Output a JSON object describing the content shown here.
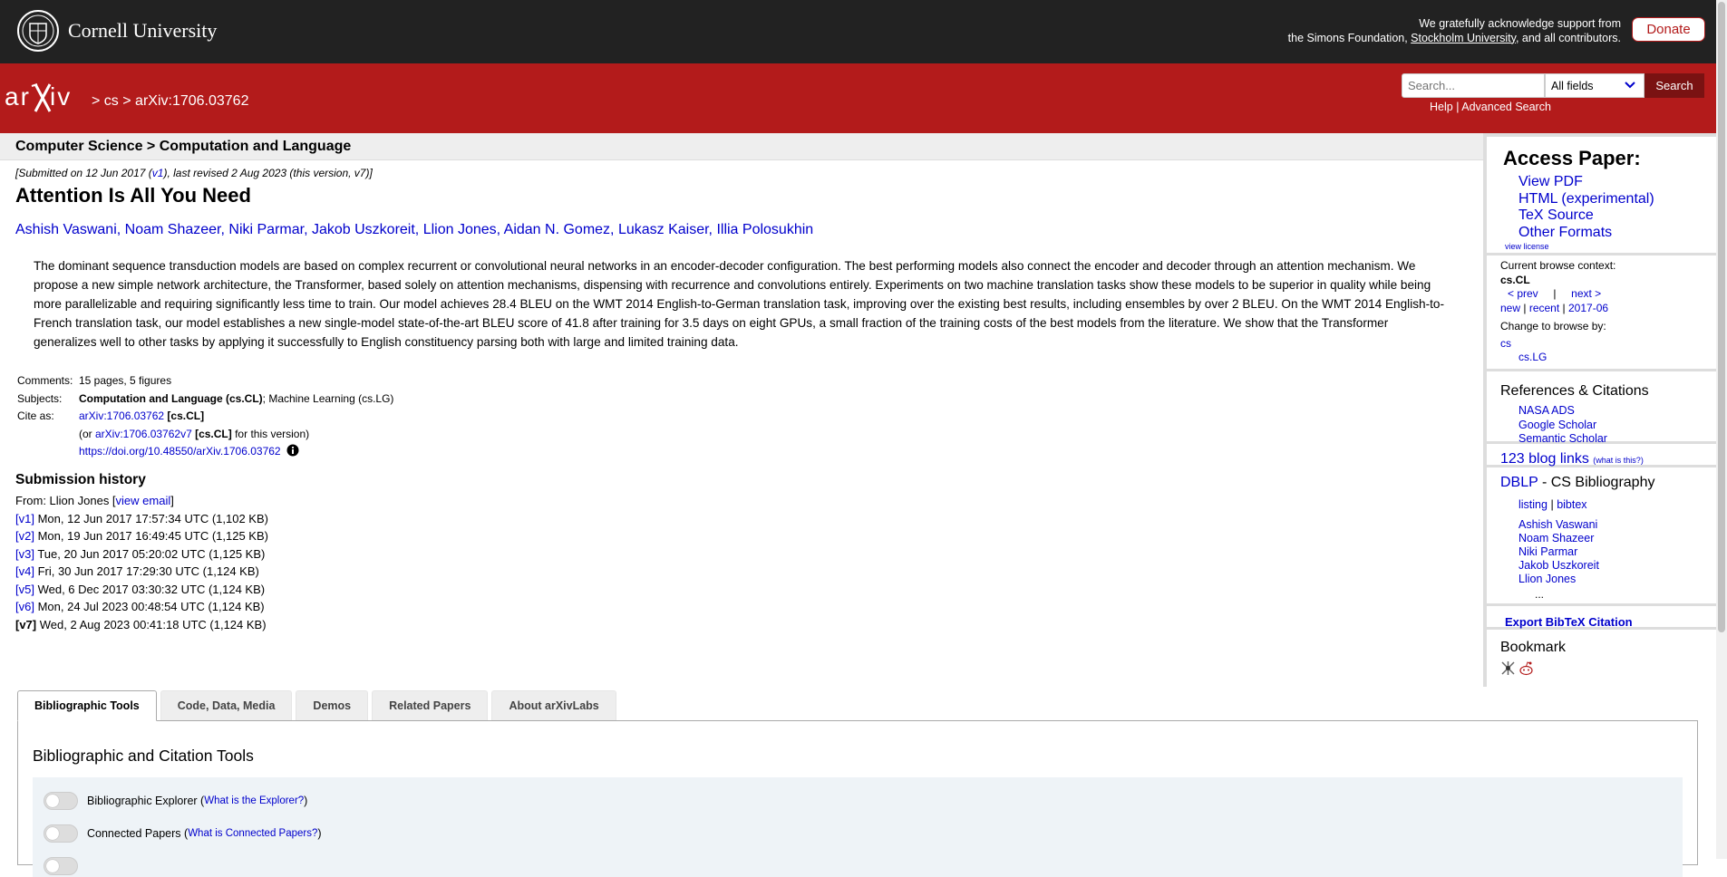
{
  "topbar": {
    "institution": "Cornell University",
    "ack_line1": "We gratefully acknowledge support from",
    "ack_line2_pre": "the Simons Foundation, ",
    "ack_link": "Stockholm University",
    "ack_line2_post": ", and all contributors.",
    "donate_label": "Donate"
  },
  "header": {
    "sep": ">",
    "crumb_cs": "cs",
    "crumb_id": "arXiv:1706.03762",
    "search_placeholder": "Search...",
    "search_field": "All fields",
    "search_button": "Search",
    "help": "Help",
    "help_sep": "|",
    "advanced": "Advanced Search",
    "colors": {
      "red": "#b31b1b",
      "dark": "#222222",
      "link": "#0000cc"
    }
  },
  "paper": {
    "category_heading": "Computer Science > Computation and Language",
    "dateline_pre": "[Submitted on 12 Jun 2017 (",
    "dateline_v1": "v1",
    "dateline_post": "), last revised 2 Aug 2023 (this version, v7)]",
    "title": "Attention Is All You Need",
    "authors": [
      "Ashish Vaswani",
      "Noam Shazeer",
      "Niki Parmar",
      "Jakob Uszkoreit",
      "Llion Jones",
      "Aidan N. Gomez",
      "Lukasz Kaiser",
      "Illia Polosukhin"
    ],
    "abstract": "The dominant sequence transduction models are based on complex recurrent or convolutional neural networks in an encoder-decoder configuration. The best performing models also connect the encoder and decoder through an attention mechanism. We propose a new simple network architecture, the Transformer, based solely on attention mechanisms, dispensing with recurrence and convolutions entirely. Experiments on two machine translation tasks show these models to be superior in quality while being more parallelizable and requiring significantly less time to train. Our model achieves 28.4 BLEU on the WMT 2014 English-to-German translation task, improving over the existing best results, including ensembles by over 2 BLEU. On the WMT 2014 English-to-French translation task, our model establishes a new single-model state-of-the-art BLEU score of 41.8 after training for 3.5 days on eight GPUs, a small fraction of the training costs of the best models from the literature. We show that the Transformer generalizes well to other tasks by applying it successfully to English constituency parsing both with large and limited training data.",
    "meta": {
      "comments_label": "Comments:",
      "comments": "15 pages, 5 figures",
      "subjects_label": "Subjects:",
      "subject_primary": "Computation and Language (cs.CL)",
      "subject_rest": "; Machine Learning (cs.LG)",
      "cite_label": "Cite as:",
      "cite_id": "arXiv:1706.03762",
      "cite_cat": " [cs.CL]",
      "cite_or_pre": "(or ",
      "cite_v7": "arXiv:1706.03762v7",
      "cite_v7_cat": " [cs.CL]",
      "cite_or_post": " for this version)",
      "doi": "https://doi.org/10.48550/arXiv.1706.03762"
    },
    "history": {
      "heading": "Submission history",
      "from_pre": "From: Llion Jones [",
      "from_link": "view email",
      "from_post": "]",
      "versions": [
        {
          "v": "[v1]",
          "text": " Mon, 12 Jun 2017 17:57:34 UTC (1,102 KB)"
        },
        {
          "v": "[v2]",
          "text": " Mon, 19 Jun 2017 16:49:45 UTC (1,125 KB)"
        },
        {
          "v": "[v3]",
          "text": " Tue, 20 Jun 2017 05:20:02 UTC (1,125 KB)"
        },
        {
          "v": "[v4]",
          "text": " Fri, 30 Jun 2017 17:29:30 UTC (1,124 KB)"
        },
        {
          "v": "[v5]",
          "text": " Wed, 6 Dec 2017 03:30:32 UTC (1,124 KB)"
        },
        {
          "v": "[v6]",
          "text": " Mon, 24 Jul 2023 00:48:54 UTC (1,124 KB)"
        },
        {
          "v": "[v7]",
          "text": " Wed, 2 Aug 2023 00:41:18 UTC (1,124 KB)"
        }
      ]
    }
  },
  "sidebar": {
    "access_heading": "Access Paper:",
    "access_links": [
      "View PDF",
      "HTML (experimental)",
      "TeX Source",
      "Other Formats"
    ],
    "license": "view license",
    "context_label": "Current browse context:",
    "context_value": "cs.CL",
    "prev": "< prev",
    "pipe": "|",
    "next": "next >",
    "new": "new",
    "recent": "recent",
    "month": "2017-06",
    "change_label": "Change to browse by:",
    "browse_cs": "cs",
    "browse_lg": "cs.LG",
    "refs_heading": "References & Citations",
    "refs": [
      "NASA ADS",
      "Google Scholar",
      "Semantic Scholar"
    ],
    "blog": "123 blog links",
    "blog_what": "(what is this?)",
    "dblp": "DBLP",
    "dblp_rest": " - CS Bibliography",
    "listing": "listing",
    "bibtex": "bibtex",
    "dblp_authors": [
      "Ashish Vaswani",
      "Noam Shazeer",
      "Niki Parmar",
      "Jakob Uszkoreit",
      "Llion Jones"
    ],
    "more": "...",
    "export": "Export BibTeX Citation",
    "bookmark": "Bookmark"
  },
  "tabs": {
    "items": [
      "Bibliographic Tools",
      "Code, Data, Media",
      "Demos",
      "Related Papers",
      "About arXivLabs"
    ],
    "panel_heading": "Bibliographic and Citation Tools",
    "tool1": "Bibliographic Explorer (",
    "tool1_link": "What is the Explorer?",
    "tool1_end": ")",
    "tool2": "Connected Papers (",
    "tool2_link": "What is Connected Papers?",
    "tool2_end": ")"
  }
}
